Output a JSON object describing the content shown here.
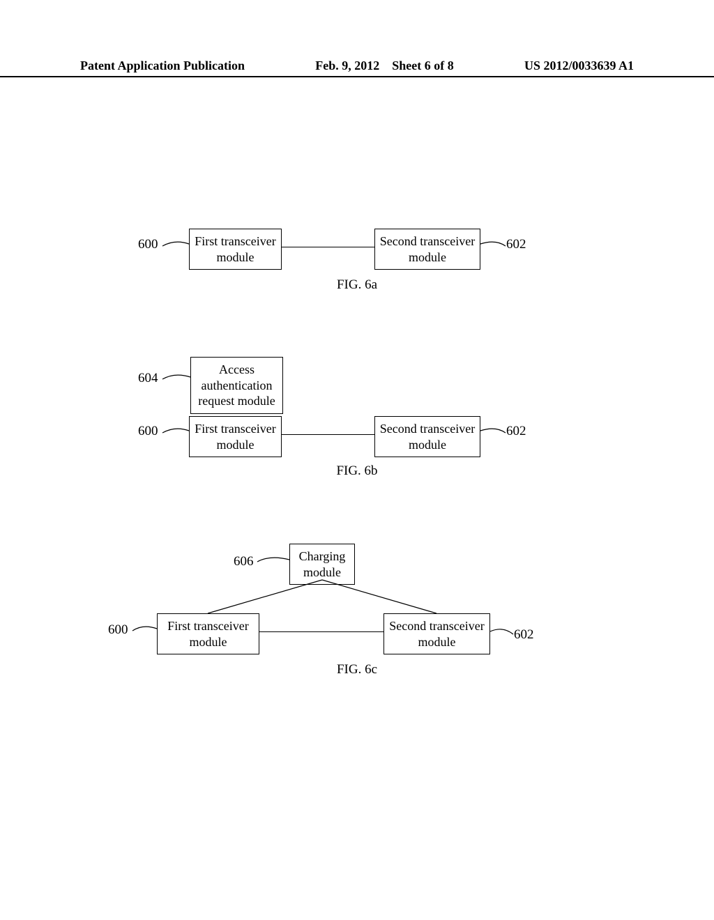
{
  "header": {
    "left": "Patent Application Publication",
    "center_date": "Feb. 9, 2012",
    "center_sheet": "Sheet 6 of 8",
    "right": "US 2012/0033639 A1"
  },
  "fig6a": {
    "first_transceiver": "First transceiver module",
    "first_ref": "600",
    "second_transceiver": "Second transceiver module",
    "second_ref": "602",
    "caption": "FIG. 6a"
  },
  "fig6b": {
    "access_auth": "Access authentication request module",
    "access_ref": "604",
    "first_transceiver": "First transceiver module",
    "first_ref": "600",
    "second_transceiver": "Second transceiver module",
    "second_ref": "602",
    "caption": "FIG. 6b"
  },
  "fig6c": {
    "charging": "Charging module",
    "charging_ref": "606",
    "first_transceiver": "First transceiver module",
    "first_ref": "600",
    "second_transceiver": "Second transceiver module",
    "second_ref": "602",
    "caption": "FIG. 6c"
  }
}
